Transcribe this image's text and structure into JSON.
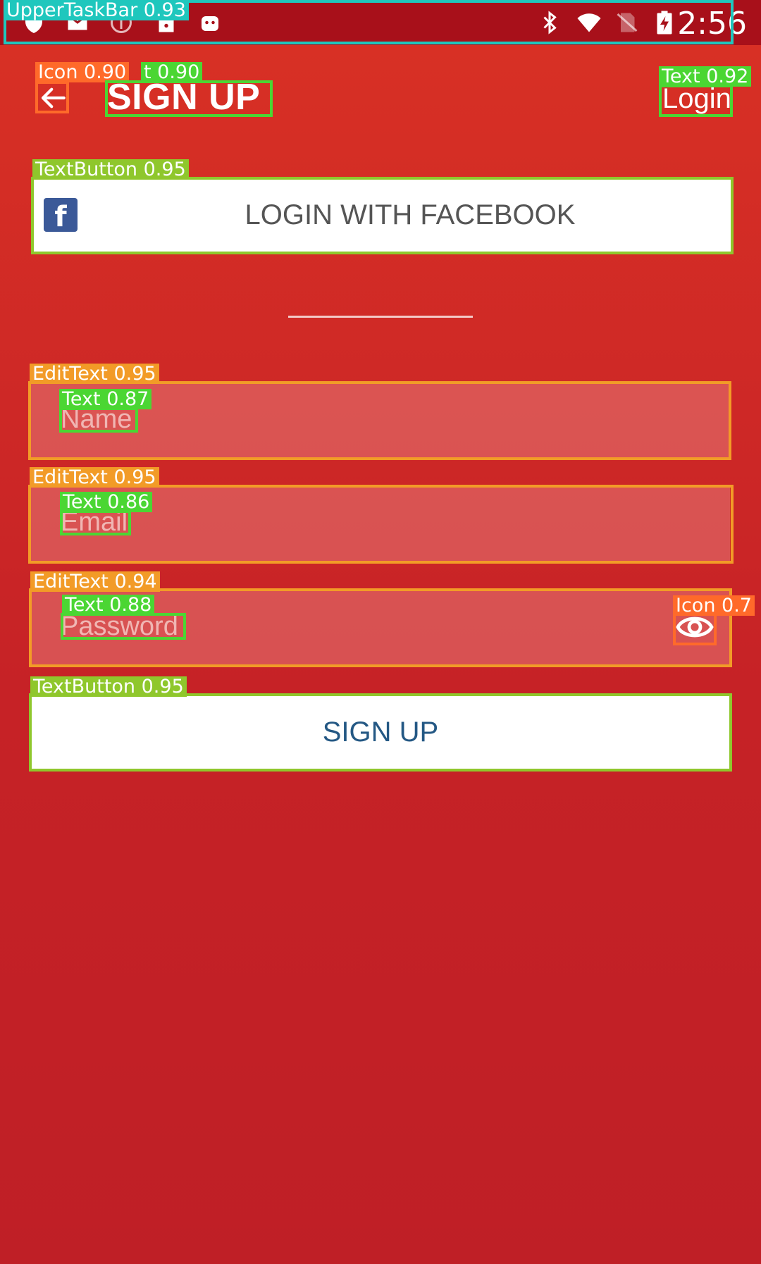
{
  "status_bar": {
    "time": "2:56",
    "left_icons": [
      "shield-icon",
      "mail-icon",
      "blocked-circle-icon",
      "lock-icon",
      "android-icon"
    ],
    "right_icons": [
      "bluetooth-icon",
      "wifi-icon",
      "no-sim-icon",
      "battery-charging-icon"
    ]
  },
  "header": {
    "back_icon": "arrow-left-icon",
    "title": "SIGN UP",
    "login_link": "Login"
  },
  "facebook_button": {
    "icon": "facebook-icon",
    "label": "LOGIN WITH FACEBOOK"
  },
  "form": {
    "name_placeholder": "Name",
    "email_placeholder": "Email",
    "password_placeholder": "Password",
    "password_toggle_icon": "eye-icon",
    "submit_label": "SIGN UP"
  },
  "annotations": {
    "status": "UpperTaskBar 0.93",
    "back_icon": "Icon 0.90",
    "title_text": "t 0.90",
    "login_text": "Text 0.92",
    "fb_button": "TextButton 0.95",
    "name_edit": "EditText 0.95",
    "name_text": "Text 0.87",
    "email_edit": "EditText 0.95",
    "email_text": "Text 0.86",
    "password_edit": "EditText 0.94",
    "password_text": "Text 0.88",
    "eye_icon": "Icon 0.7",
    "signup_button": "TextButton 0.95"
  },
  "colors": {
    "background_top": "#d93125",
    "background_bottom": "#bf1f26",
    "status_bar": "#a8101a",
    "facebook_blue": "#3b5998",
    "signup_text": "#245884",
    "ann_cyan": "#1fc7bd",
    "ann_green": "#8fc72c",
    "ann_bright_green": "#4bd633",
    "ann_orange": "#f29b27",
    "ann_dark_orange": "#ff6a2a"
  }
}
